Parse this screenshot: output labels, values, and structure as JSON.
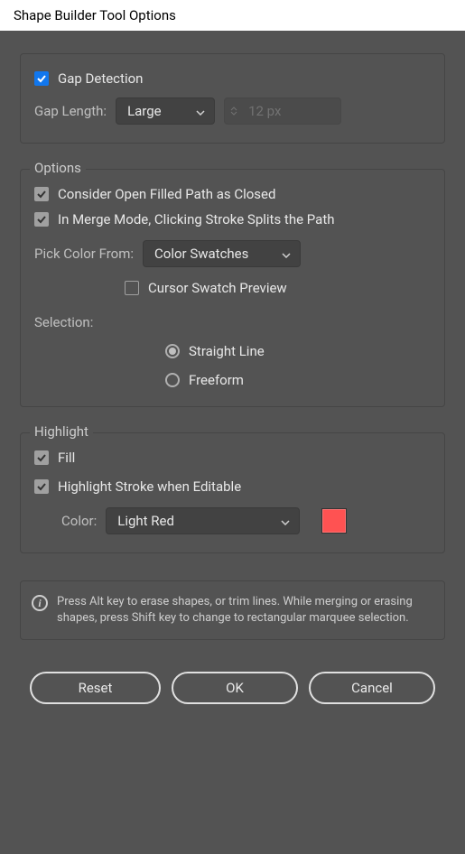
{
  "title": "Shape Builder Tool Options",
  "gapDetection": {
    "label": "Gap Detection",
    "checked": true,
    "gapLengthLabel": "Gap Length:",
    "gapLengthValue": "Large",
    "gapPx": "12 px"
  },
  "options": {
    "title": "Options",
    "considerOpenLabel": "Consider Open Filled Path as Closed",
    "considerOpenChecked": true,
    "mergeModeLabel": "In Merge Mode, Clicking Stroke Splits the Path",
    "mergeModeChecked": true,
    "pickColorFromLabel": "Pick Color From:",
    "pickColorFromValue": "Color Swatches",
    "cursorSwatchLabel": "Cursor Swatch Preview",
    "cursorSwatchChecked": false,
    "selectionLabel": "Selection:",
    "selectionOptions": {
      "straightLine": "Straight Line",
      "freeform": "Freeform"
    },
    "selectedSelection": "straightLine"
  },
  "highlight": {
    "title": "Highlight",
    "fillLabel": "Fill",
    "fillChecked": true,
    "strokeLabel": "Highlight Stroke when Editable",
    "strokeChecked": true,
    "colorLabel": "Color:",
    "colorValue": "Light Red",
    "colorHex": "#ff5252"
  },
  "info": "Press Alt key to erase shapes, or trim lines. While merging or erasing shapes, press Shift key to change to rectangular marquee selection.",
  "buttons": {
    "reset": "Reset",
    "ok": "OK",
    "cancel": "Cancel"
  }
}
